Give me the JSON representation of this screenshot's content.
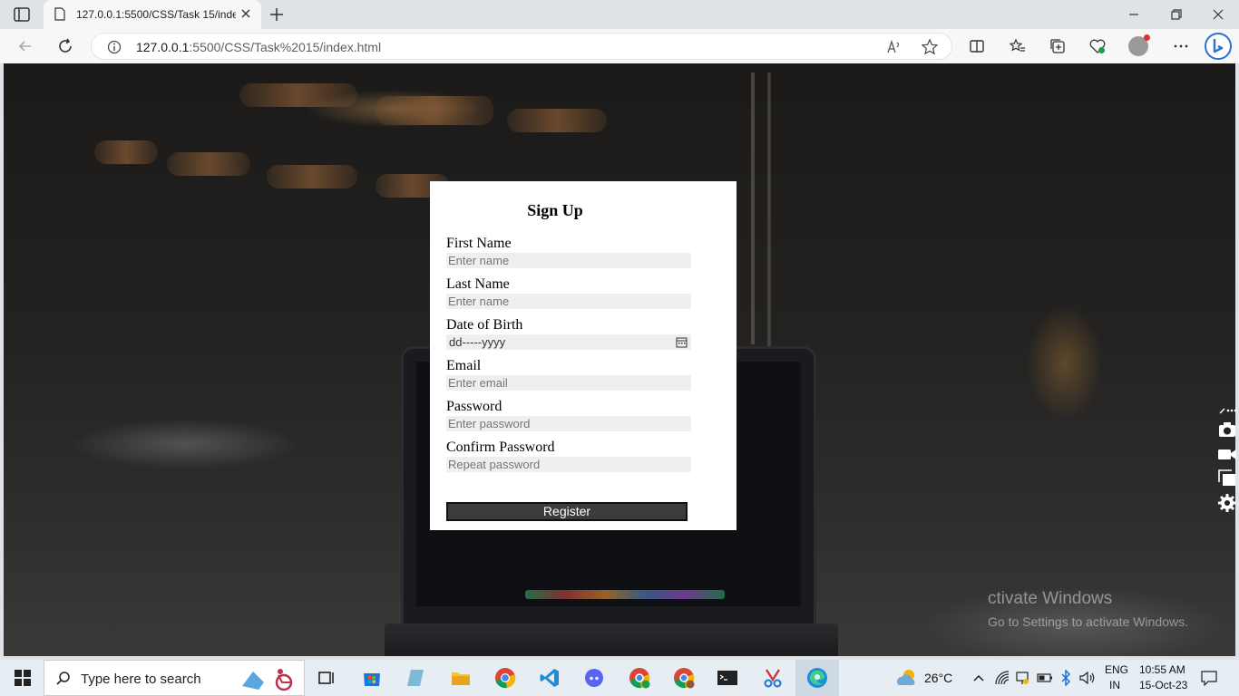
{
  "browser": {
    "tab_title": "127.0.0.1:5500/CSS/Task 15/index.html",
    "url_host": "127.0.0.1",
    "url_rest": ":5500/CSS/Task%2015/index.html"
  },
  "form": {
    "title": "Sign Up",
    "fields": [
      {
        "label": "First Name",
        "placeholder": "Enter name"
      },
      {
        "label": "Last Name",
        "placeholder": "Enter name"
      },
      {
        "label": "Date of Birth",
        "placeholder": "dd-----yyyy"
      },
      {
        "label": "Email",
        "placeholder": "Enter email"
      },
      {
        "label": "Password",
        "placeholder": "Enter password"
      },
      {
        "label": "Confirm Password",
        "placeholder": "Repeat password"
      }
    ],
    "submit_label": "Register"
  },
  "watermark": {
    "line1": "ctivate Windows",
    "line2": "Go to Settings to activate Windows."
  },
  "taskbar": {
    "search_placeholder": "Type here to search",
    "weather": "26°C",
    "lang_top": "ENG",
    "lang_bottom": "IN",
    "time": "10:55 AM",
    "date": "15-Oct-23"
  },
  "colors": {
    "card_bg": "#ffffff",
    "input_bg": "#efefef",
    "button_bg": "#3b3b3b",
    "taskbar_bg": "#e6edf3"
  }
}
